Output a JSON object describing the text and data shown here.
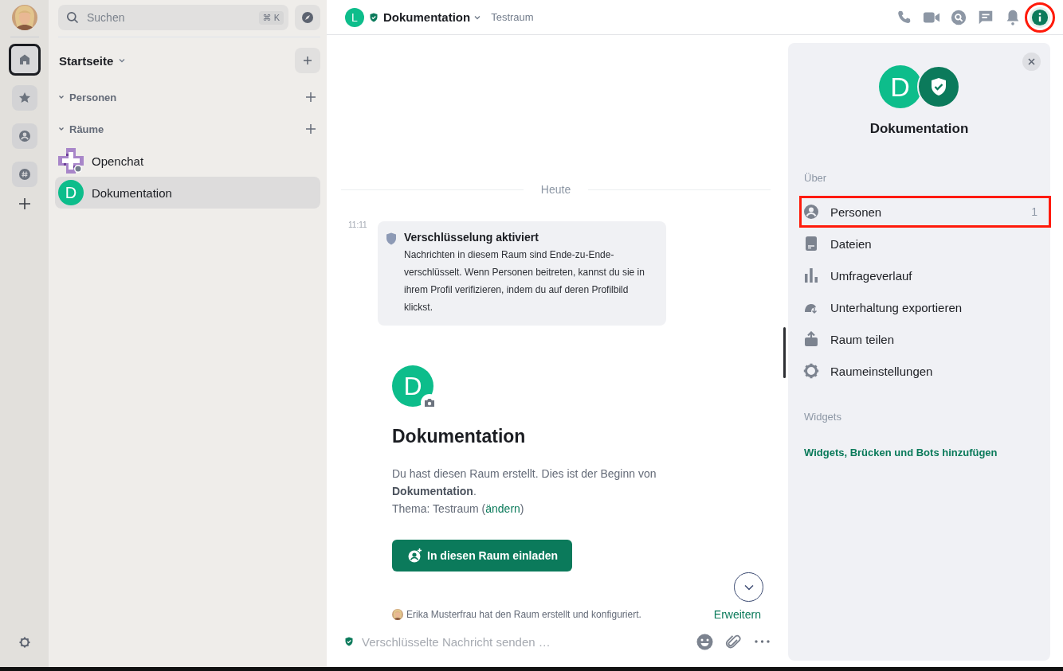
{
  "rail": {
    "spaces": [
      {
        "kind": "home",
        "selected": true
      },
      {
        "kind": "favourites",
        "selected": false
      },
      {
        "kind": "people",
        "selected": false
      },
      {
        "kind": "rooms",
        "selected": false
      }
    ]
  },
  "search": {
    "placeholder": "Suchen",
    "shortcut": "⌘ K"
  },
  "home": {
    "title": "Startseite"
  },
  "sections": [
    {
      "label": "Personen",
      "expanded": true
    },
    {
      "label": "Räume",
      "expanded": true,
      "rooms": [
        {
          "name": "Openchat",
          "kind": "logo",
          "selected": false
        },
        {
          "name": "Dokumentation",
          "kind": "letter",
          "letter": "D",
          "selected": false,
          "current": true
        }
      ]
    }
  ],
  "header": {
    "avatar_letter": "L",
    "verified": true,
    "title": "Dokumentation",
    "topic": "Testraum",
    "actions": [
      {
        "kind": "call",
        "selected": false,
        "highlighted": false
      },
      {
        "kind": "video",
        "selected": false,
        "highlighted": false
      },
      {
        "kind": "search",
        "selected": false,
        "highlighted": false
      },
      {
        "kind": "threads",
        "selected": false,
        "highlighted": false
      },
      {
        "kind": "notifications",
        "selected": false,
        "highlighted": false
      },
      {
        "kind": "info",
        "selected": true,
        "highlighted": true
      }
    ]
  },
  "timeline": {
    "date": "Heute",
    "encryption_notice": {
      "time": "11:11",
      "title": "Verschlüsselung aktiviert",
      "text": "Nachrichten in diesem Raum sind Ende-zu-Ende-verschlüsselt. Wenn Personen beitreten, kannst du sie in ihrem Profil verifizieren, indem du auf deren Profilbild klickst."
    },
    "room_intro": {
      "avatar_letter": "D",
      "title": "Dokumentation",
      "text": "Du hast diesen Raum erstellt. Dies ist der Beginn von **Dokumentation**.",
      "topic_before": "Thema: Testraum (",
      "topic_link": "ändern",
      "topic_after": ")",
      "invite_button": "In diesen Raum einladen"
    },
    "created_event": {
      "text": "Erika Musterfrau hat den Raum erstellt und konfiguriert.",
      "action": "Erweitern"
    }
  },
  "composer": {
    "encrypted": true,
    "placeholder": "Verschlüsselte Nachricht senden …"
  },
  "right_panel": {
    "avatar_letter": "D",
    "verified": true,
    "title": "Dokumentation",
    "about_heading": "Über",
    "items": [
      {
        "kind": "people",
        "label": "Personen",
        "count": "1",
        "highlighted": true
      },
      {
        "kind": "files",
        "label": "Dateien",
        "highlighted": false
      },
      {
        "kind": "polls",
        "label": "Umfrageverlauf",
        "highlighted": false
      },
      {
        "kind": "export",
        "label": "Unterhaltung exportieren",
        "highlighted": false
      },
      {
        "kind": "share",
        "label": "Raum teilen",
        "highlighted": false
      },
      {
        "kind": "settings",
        "label": "Raumeinstellungen",
        "highlighted": false
      }
    ],
    "widgets_heading": "Widgets",
    "widgets_link": "Widgets, Brücken und Bots hinzufügen"
  }
}
